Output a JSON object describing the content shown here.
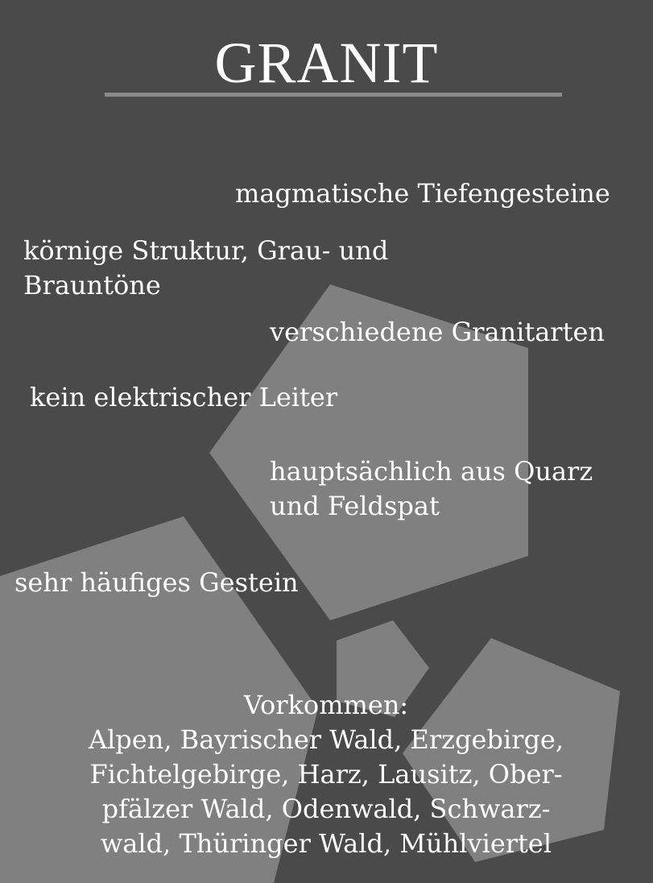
{
  "title": "GRANIT",
  "facts": [
    "magmatische Tiefengesteine",
    "körnige Struktur, Grau- und Brauntöne",
    "verschiedene Granitarten",
    "kein elektrischer Leiter",
    "hauptsächlich aus Quarz und Feldspat",
    "sehr häufiges Gestein"
  ],
  "occurrence": {
    "heading": "Vorkommen:",
    "lines": [
      "Alpen, Bayrischer Wald, Erzgebirge,",
      "Fichtelgebirge, Harz, Lausitz, Ober-",
      "pfälzer Wald, Odenwald, Schwarz-",
      "wald, Thüringer Wald, Mühlviertel"
    ]
  },
  "colors": {
    "background": "#4a4a4a",
    "shapes": "#808080",
    "text": "#ffffff",
    "rule": "#8a8a8a"
  }
}
